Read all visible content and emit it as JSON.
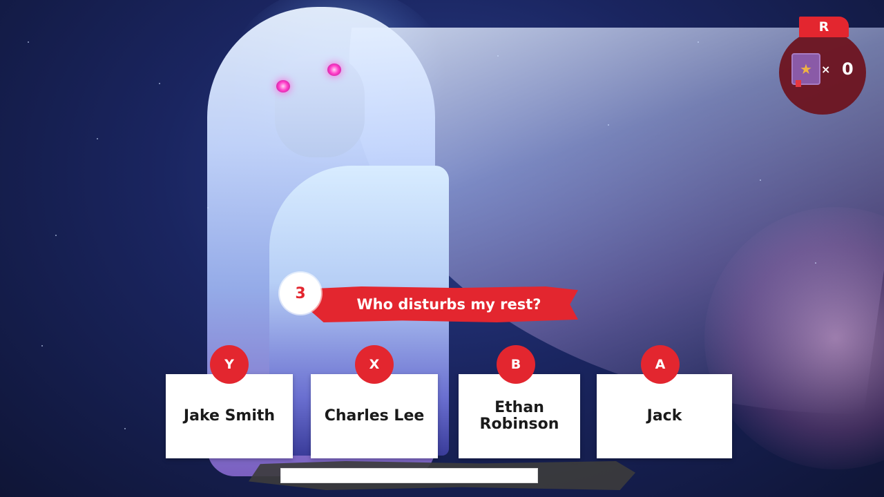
{
  "hud": {
    "button_label": "R",
    "item_icon": "spellbook-icon",
    "multiplier": "×",
    "count": "0"
  },
  "question": {
    "number": "3",
    "text": "Who disturbs my rest?"
  },
  "answers": [
    {
      "button": "Y",
      "text": "Jake Smith"
    },
    {
      "button": "X",
      "text": "Charles Lee"
    },
    {
      "button": "B",
      "text": "Ethan Robinson"
    },
    {
      "button": "A",
      "text": "Jack"
    }
  ],
  "colors": {
    "accent_red": "#e3262f",
    "hud_dark_red": "#6e1420",
    "card_white": "#ffffff"
  }
}
